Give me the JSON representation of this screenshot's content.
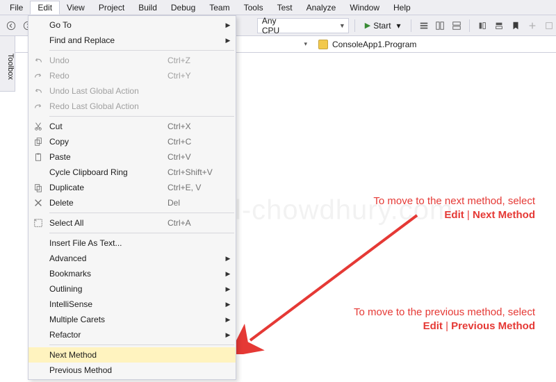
{
  "menubar": [
    "File",
    "Edit",
    "View",
    "Project",
    "Build",
    "Debug",
    "Team",
    "Tools",
    "Test",
    "Analyze",
    "Window",
    "Help"
  ],
  "active_menu_index": 1,
  "toolbar": {
    "config_label": "Any CPU",
    "start_label": "Start"
  },
  "breadcrumb": {
    "right": "ConsoleApp1.Program"
  },
  "toolbox_tab": "Toolbox",
  "watermark": "www.kunal-chowdhury.com",
  "menu": {
    "groups": [
      [
        {
          "icon": "",
          "label": "Go To",
          "shortcut": "",
          "submenu": true
        },
        {
          "icon": "",
          "label": "Find and Replace",
          "shortcut": "",
          "submenu": true
        }
      ],
      [
        {
          "icon": "undo",
          "label": "Undo",
          "shortcut": "Ctrl+Z",
          "disabled": true
        },
        {
          "icon": "redo",
          "label": "Redo",
          "shortcut": "Ctrl+Y",
          "disabled": true
        },
        {
          "icon": "undo",
          "label": "Undo Last Global Action",
          "shortcut": "",
          "disabled": true
        },
        {
          "icon": "redo",
          "label": "Redo Last Global Action",
          "shortcut": "",
          "disabled": true
        }
      ],
      [
        {
          "icon": "cut",
          "label": "Cut",
          "shortcut": "Ctrl+X"
        },
        {
          "icon": "copy",
          "label": "Copy",
          "shortcut": "Ctrl+C"
        },
        {
          "icon": "paste",
          "label": "Paste",
          "shortcut": "Ctrl+V"
        },
        {
          "icon": "",
          "label": "Cycle Clipboard Ring",
          "shortcut": "Ctrl+Shift+V"
        },
        {
          "icon": "duplicate",
          "label": "Duplicate",
          "shortcut": "Ctrl+E, V"
        },
        {
          "icon": "delete",
          "label": "Delete",
          "shortcut": "Del"
        }
      ],
      [
        {
          "icon": "selectall",
          "label": "Select All",
          "shortcut": "Ctrl+A"
        }
      ],
      [
        {
          "icon": "",
          "label": "Insert File As Text...",
          "shortcut": ""
        },
        {
          "icon": "",
          "label": "Advanced",
          "shortcut": "",
          "submenu": true
        },
        {
          "icon": "",
          "label": "Bookmarks",
          "shortcut": "",
          "submenu": true
        },
        {
          "icon": "",
          "label": "Outlining",
          "shortcut": "",
          "submenu": true
        },
        {
          "icon": "",
          "label": "IntelliSense",
          "shortcut": "",
          "submenu": true
        },
        {
          "icon": "",
          "label": "Multiple Carets",
          "shortcut": "",
          "submenu": true
        },
        {
          "icon": "",
          "label": "Refactor",
          "shortcut": "",
          "submenu": true
        }
      ],
      [
        {
          "icon": "",
          "label": "Next Method",
          "shortcut": "",
          "highlight": true
        },
        {
          "icon": "",
          "label": "Previous Method",
          "shortcut": ""
        }
      ]
    ]
  },
  "annot1": {
    "line1": "To move to the next method, select",
    "line2_a": "Edit",
    "line2_sep": " | ",
    "line2_b": "Next Method"
  },
  "annot2": {
    "line1": "To move to the previous method, select",
    "line2_a": "Edit",
    "line2_sep": " | ",
    "line2_b": "Previous Method"
  }
}
